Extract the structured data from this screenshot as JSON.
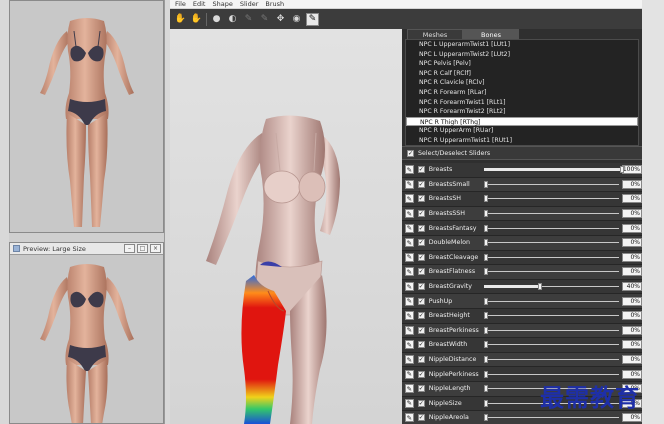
{
  "menu": [
    "File",
    "Edit",
    "Shape",
    "Slider",
    "Brush"
  ],
  "toolbar_icons": [
    {
      "name": "select-tool-icon",
      "glyph": "✋",
      "state": "normal"
    },
    {
      "name": "transform-tool-icon",
      "glyph": "✋",
      "state": "normal"
    },
    {
      "name": "sphere-tool-icon",
      "glyph": "●",
      "state": "normal"
    },
    {
      "name": "mask-tool-icon",
      "glyph": "◐",
      "state": "normal"
    },
    {
      "name": "inflate-brush-icon",
      "glyph": "✎",
      "state": "dim"
    },
    {
      "name": "deflate-brush-icon",
      "glyph": "✎",
      "state": "dim"
    },
    {
      "name": "move-brush-icon",
      "glyph": "✥",
      "state": "normal"
    },
    {
      "name": "smooth-brush-icon",
      "glyph": "◉",
      "state": "normal"
    },
    {
      "name": "weight-brush-icon",
      "glyph": "✎",
      "state": "active"
    }
  ],
  "preview_window": {
    "title": "Preview: Large Size"
  },
  "tabs": [
    {
      "label": "Meshes",
      "active": false
    },
    {
      "label": "Bones",
      "active": true
    }
  ],
  "bones": [
    {
      "label": "NPC L UpperarmTwist1 [LUt1]",
      "selected": false
    },
    {
      "label": "NPC L UpperarmTwist2 [LUt2]",
      "selected": false
    },
    {
      "label": "NPC Pelvis [Pelv]",
      "selected": false
    },
    {
      "label": "NPC R Calf [RClf]",
      "selected": false
    },
    {
      "label": "NPC R Clavicle [RClv]",
      "selected": false
    },
    {
      "label": "NPC R Forearm [RLar]",
      "selected": false
    },
    {
      "label": "NPC R ForearmTwist1 [RLt1]",
      "selected": false
    },
    {
      "label": "NPC R ForearmTwist2 [RLt2]",
      "selected": false
    },
    {
      "label": "NPC R Thigh [RThg]",
      "selected": true
    },
    {
      "label": "NPC R UpperArm [RUar]",
      "selected": false
    },
    {
      "label": "NPC R UpperarmTwist1 [RUt1]",
      "selected": false
    }
  ],
  "select_all_label": "Select/Deselect Sliders",
  "sliders": [
    {
      "name": "Breasts",
      "value": 100,
      "display": "100%"
    },
    {
      "name": "BreastsSmall",
      "value": 0,
      "display": "0%"
    },
    {
      "name": "BreastsSH",
      "value": 0,
      "display": "0%"
    },
    {
      "name": "BreastsSSH",
      "value": 0,
      "display": "0%"
    },
    {
      "name": "BreastsFantasy",
      "value": 0,
      "display": "0%"
    },
    {
      "name": "DoubleMelon",
      "value": 0,
      "display": "0%"
    },
    {
      "name": "BreastCleavage",
      "value": 0,
      "display": "0%"
    },
    {
      "name": "BreastFlatness",
      "value": 0,
      "display": "0%"
    },
    {
      "name": "BreastGravity",
      "value": 40,
      "display": "40%"
    },
    {
      "name": "PushUp",
      "value": 0,
      "display": "0%"
    },
    {
      "name": "BreastHeight",
      "value": 0,
      "display": "0%"
    },
    {
      "name": "BreastPerkiness",
      "value": 0,
      "display": "0%"
    },
    {
      "name": "BreastWidth",
      "value": 0,
      "display": "0%"
    },
    {
      "name": "NippleDistance",
      "value": 0,
      "display": "0%"
    },
    {
      "name": "NipplePerkiness",
      "value": 0,
      "display": "0%"
    },
    {
      "name": "NippleLength",
      "value": 0,
      "display": "0%"
    },
    {
      "name": "NippleSize",
      "value": 0,
      "display": "0%"
    },
    {
      "name": "NippleAreola",
      "value": 0,
      "display": "0%"
    }
  ],
  "watermark": "最需教育",
  "colors": {
    "panel_bg": "#2f2f2f",
    "weight_hot": "#e0150f",
    "weight_cold": "#1a4fd8",
    "skin": "#d9a78f",
    "underwear": "#3d3a4a"
  }
}
